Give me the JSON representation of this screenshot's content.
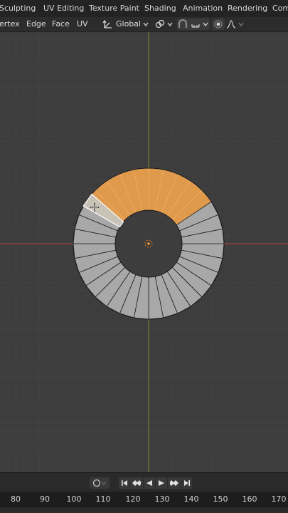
{
  "workspace_tabs": [
    "Sculpting",
    "UV Editing",
    "Texture Paint",
    "Shading",
    "Animation",
    "Rendering",
    "Com"
  ],
  "menu": [
    "ertex",
    "Edge",
    "Face",
    "UV"
  ],
  "transform_orientation": "Global",
  "timeline": {
    "frame_numbers": [
      "80",
      "90",
      "100",
      "110",
      "120",
      "130",
      "140",
      "150",
      "160",
      "170"
    ]
  },
  "colors": {
    "selected_face": "#e09a4c",
    "mesh": "#a8a8a8",
    "x_axis": "#b24040",
    "y_axis": "#7c9a2c"
  }
}
